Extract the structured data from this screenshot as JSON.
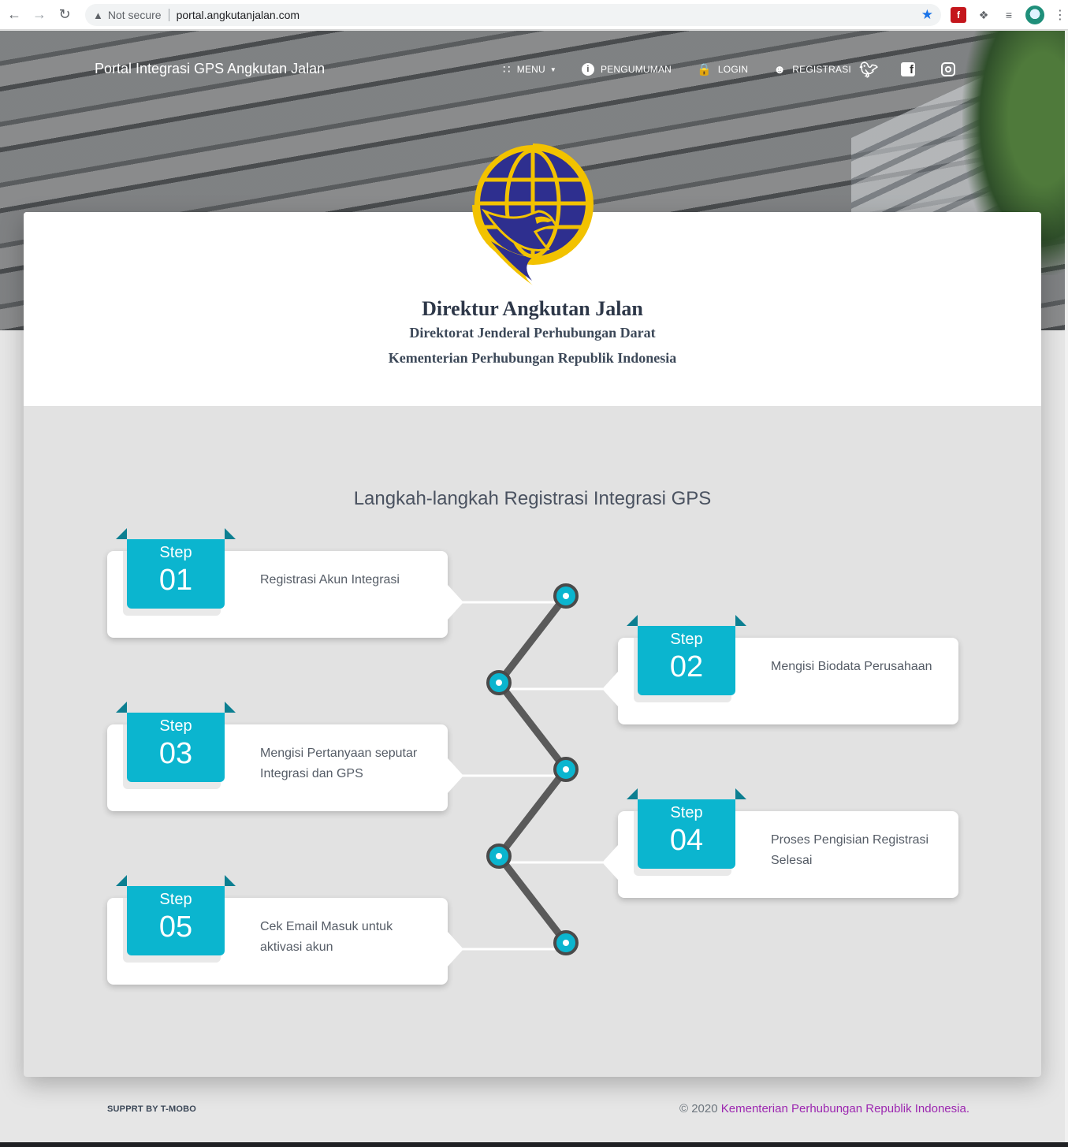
{
  "browser": {
    "security_label": "Not secure",
    "url": "portal.angkutanjalan.com"
  },
  "header": {
    "brand": "Portal Integrasi GPS Angkutan Jalan",
    "nav": [
      {
        "label": "MENU",
        "icon": "grid-icon"
      },
      {
        "label": "PENGUMUMAN",
        "icon": "info-icon"
      },
      {
        "label": "LOGIN",
        "icon": "lock-icon"
      },
      {
        "label": "REGISTRASI",
        "icon": "user-check-icon"
      }
    ],
    "social": [
      "twitter-icon",
      "facebook-icon",
      "instagram-icon"
    ]
  },
  "org": {
    "title": "Direktur Angkutan Jalan",
    "subtitle1": "Direktorat Jenderal Perhubungan Darat",
    "subtitle2": "Kementerian Perhubungan Republik Indonesia"
  },
  "steps_section": {
    "title": "Langkah-langkah Registrasi Integrasi GPS",
    "step_label": "Step",
    "steps": [
      {
        "num": "01",
        "text": "Registrasi Akun Integrasi"
      },
      {
        "num": "02",
        "text": "Mengisi Biodata Perusahaan"
      },
      {
        "num": "03",
        "text": "Mengisi Pertanyaan seputar Integrasi dan GPS"
      },
      {
        "num": "04",
        "text": "Proses Pengisian Registrasi Selesai"
      },
      {
        "num": "05",
        "text": "Cek Email Masuk untuk aktivasi akun"
      }
    ]
  },
  "footer": {
    "left": "SUPPRT BY T-MOBO",
    "copyright": "© 2020",
    "org_link": "Kementerian Perhubungan Republik Indonesia."
  },
  "colors": {
    "accent": "#0bb5cf",
    "accent_dark": "#0c7f91",
    "link": "#9c27b0",
    "logo_blue": "#2e2f8f",
    "logo_gold": "#f2c200"
  }
}
